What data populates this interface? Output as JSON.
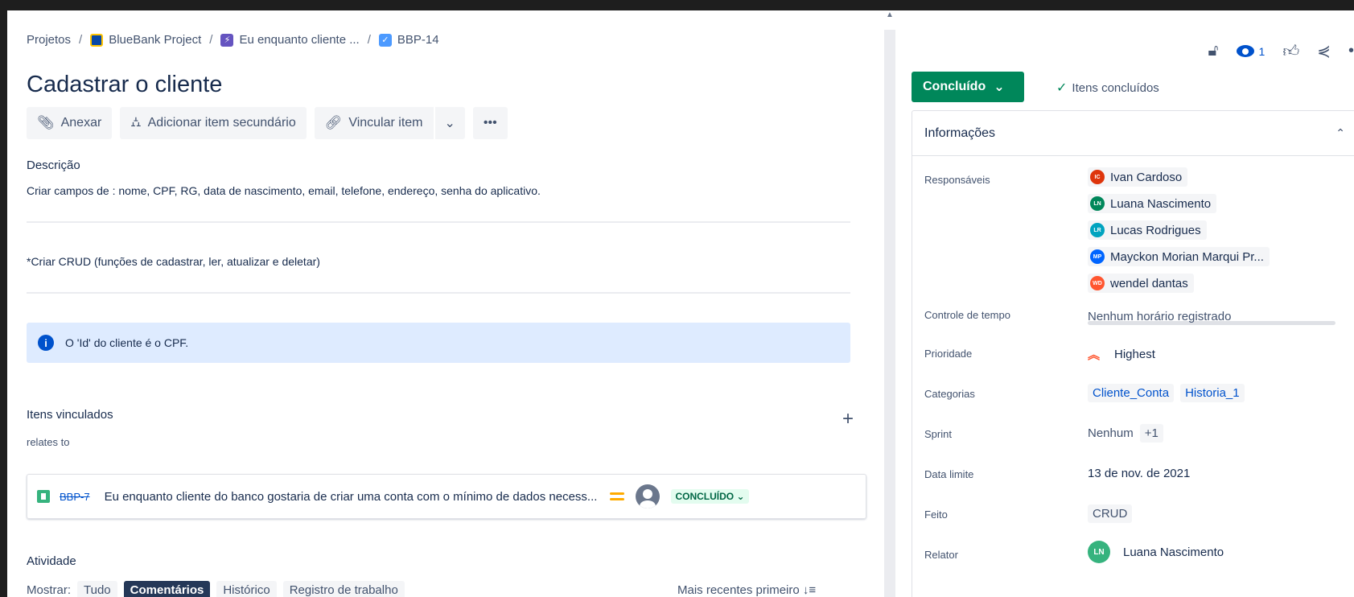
{
  "breadcrumb": {
    "root": "Projetos",
    "project": "BlueBank Project",
    "epic": "Eu enquanto cliente ...",
    "issue_key": "BBP-14"
  },
  "issue": {
    "title": "Cadastrar o cliente"
  },
  "toolbar": {
    "attach": "Anexar",
    "add_child": "Adicionar item secundário",
    "link": "Vincular item",
    "more": "•••"
  },
  "description": {
    "label": "Descrição",
    "line1": "Criar campos de : nome, CPF, RG, data de nascimento, email, telefone, endereço, senha do aplicativo.",
    "line2": "*Criar CRUD (funções de cadastrar, ler, atualizar e deletar)",
    "info_panel": "O 'Id' do cliente é o CPF."
  },
  "linked_items": {
    "label": "Itens vinculados",
    "relation": "relates to",
    "items": [
      {
        "key": "BBP-7",
        "summary": "Eu enquanto cliente do banco gostaria de criar uma conta com o mínimo de dados necess...",
        "status": "CONCLUÍDO"
      }
    ]
  },
  "activity": {
    "label": "Atividade",
    "show_label": "Mostrar:",
    "filters": [
      "Tudo",
      "Comentários",
      "Histórico",
      "Registro de trabalho"
    ],
    "active_filter": "Comentários",
    "sort": "Mais recentes primeiro"
  },
  "header_actions": {
    "watchers_count": "1"
  },
  "status": {
    "label": "Concluído",
    "resolution_note": "Itens concluídos"
  },
  "details": {
    "heading": "Informações",
    "assignees_label": "Responsáveis",
    "assignees": [
      {
        "name": "Ivan Cardoso",
        "initials": "IC",
        "color": "#de350b"
      },
      {
        "name": "Luana Nascimento",
        "initials": "LN",
        "color": "#00875a"
      },
      {
        "name": "Lucas Rodrigues",
        "initials": "LR",
        "color": "#00a3bf"
      },
      {
        "name": "Mayckon Morian Marqui Pr...",
        "initials": "MP",
        "color": "#0065ff"
      },
      {
        "name": "wendel dantas",
        "initials": "WD",
        "color": "#ff5630"
      }
    ],
    "time_tracking_label": "Controle de tempo",
    "time_tracking_value": "Nenhum horário registrado",
    "priority_label": "Prioridade",
    "priority_value": "Highest",
    "labels_label": "Categorias",
    "labels": [
      "Cliente_Conta",
      "Historia_1"
    ],
    "sprint_label": "Sprint",
    "sprint_value": "Nenhum",
    "sprint_extra": "+1",
    "due_label": "Data limite",
    "due_value": "13 de nov. de 2021",
    "done_label": "Feito",
    "done_value": "CRUD",
    "reporter_label": "Relator",
    "reporter_name": "Luana Nascimento",
    "reporter_initials": "LN"
  }
}
